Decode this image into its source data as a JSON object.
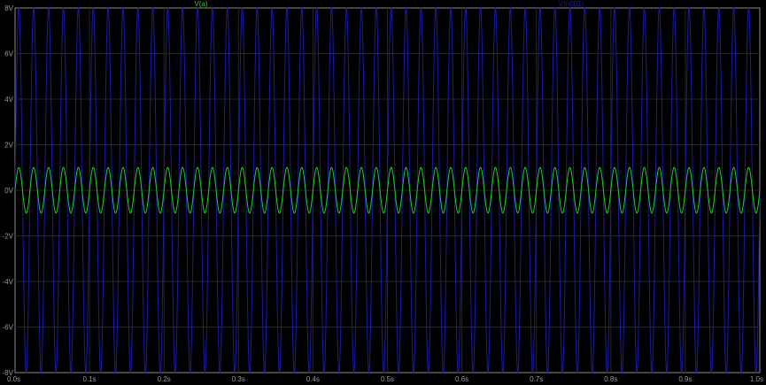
{
  "chart_data": {
    "type": "line",
    "xlim": [
      0,
      1.0
    ],
    "ylim": [
      -8,
      8
    ],
    "x_tick_labels": [
      "0.0s",
      "0.1s",
      "0.2s",
      "0.3s",
      "0.4s",
      "0.5s",
      "0.6s",
      "0.7s",
      "0.8s",
      "0.9s",
      "1.0s"
    ],
    "x_ticks": [
      0,
      0.1,
      0.2,
      0.3,
      0.4,
      0.5,
      0.6,
      0.7,
      0.8,
      0.9,
      1.0
    ],
    "y_tick_labels": [
      "8V",
      "6V",
      "4V",
      "2V",
      "0V",
      "-2V",
      "-4V",
      "-6V",
      "-8V"
    ],
    "y_ticks": [
      8,
      6,
      4,
      2,
      0,
      -2,
      -4,
      -6,
      -8
    ],
    "grid": true,
    "legend_placement": "top",
    "series": [
      {
        "name": "V(a)",
        "color": "#22cc22",
        "amplitude": 1,
        "frequency": 50,
        "phase": 0
      },
      {
        "name": "V(n001)",
        "color": "#1a1aa8",
        "amplitude": 8,
        "frequency": 50,
        "phase": 0
      }
    ]
  },
  "colors": {
    "background": "#000000",
    "frame": "#8a8a8a",
    "grid": "#262626",
    "tick_text": "#9a9a9a"
  }
}
